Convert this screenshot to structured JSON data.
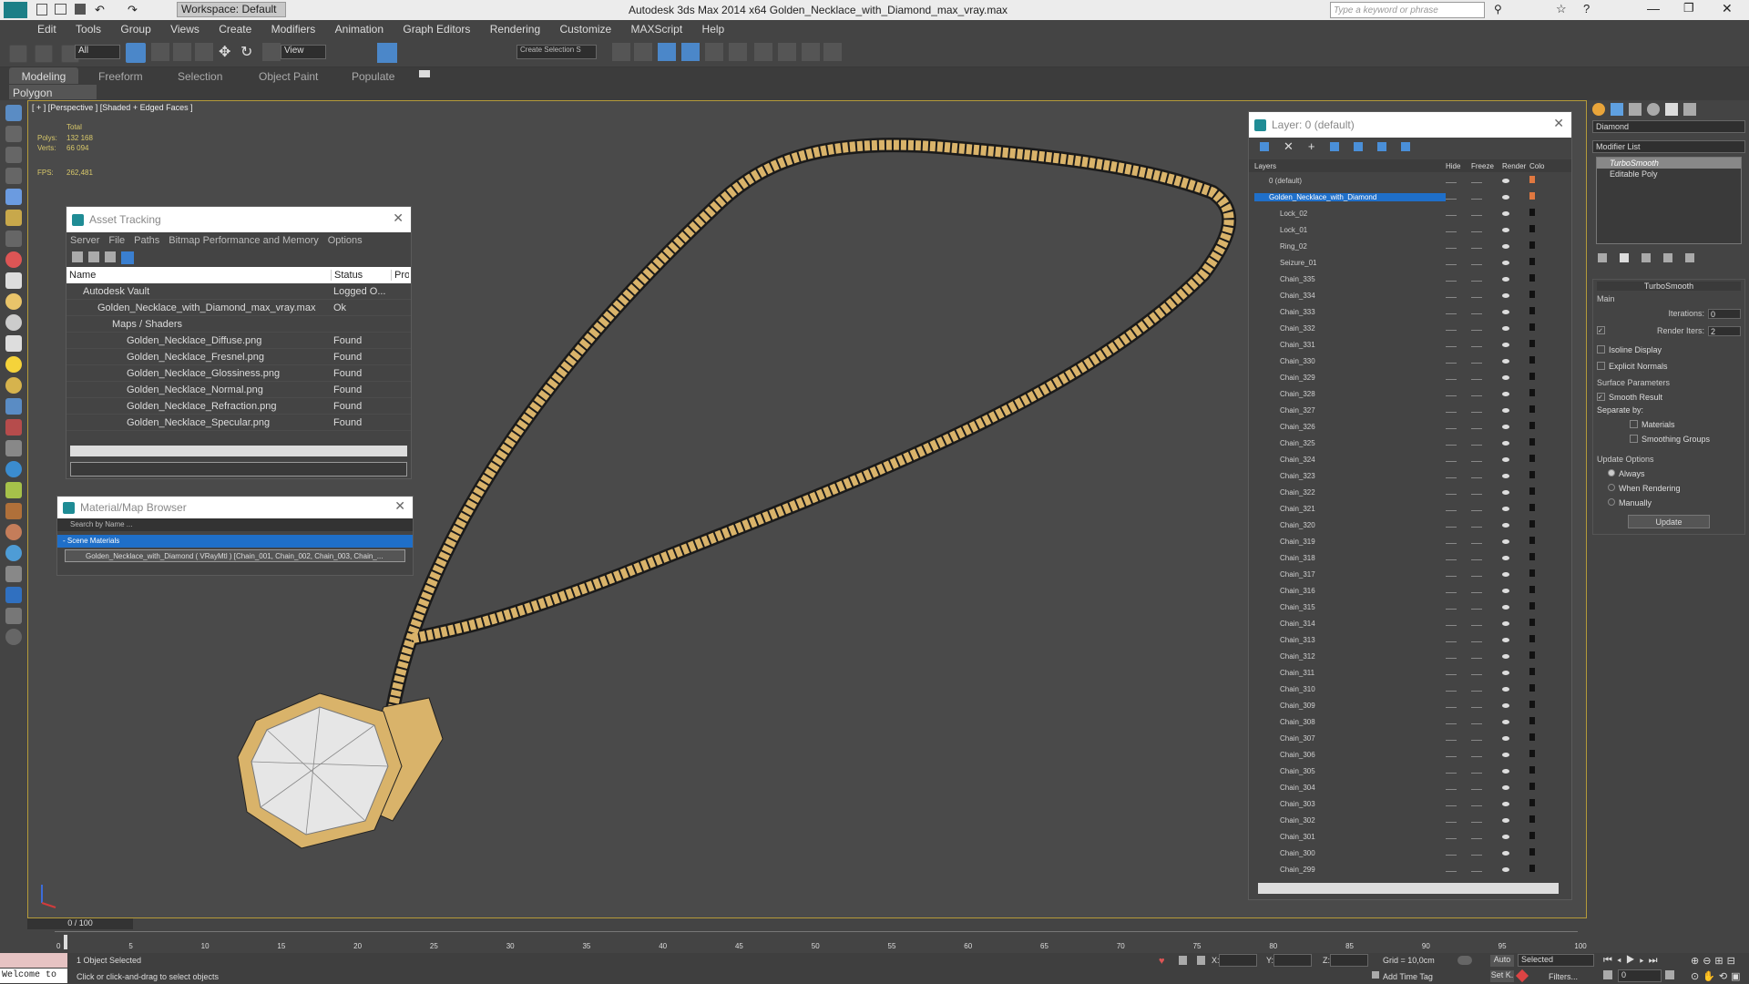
{
  "app": {
    "title": "Autodesk 3ds Max  2014 x64     Golden_Necklace_with_Diamond_max_vray.max",
    "workspace": "Workspace: Default",
    "search_placeholder": "Type a keyword or phrase"
  },
  "menu": [
    "Edit",
    "Tools",
    "Group",
    "Views",
    "Create",
    "Modifiers",
    "Animation",
    "Graph Editors",
    "Rendering",
    "Customize",
    "MAXScript",
    "Help"
  ],
  "toolbar": {
    "filter": "All",
    "ref": "View",
    "selset": "Create Selection S"
  },
  "ribbon": {
    "tabs": [
      "Modeling",
      "Freeform",
      "Selection",
      "Object Paint",
      "Populate"
    ],
    "sub": "Polygon Modeling"
  },
  "viewport": {
    "label": "[ + ] [Perspective ] [Shaded + Edged Faces ]",
    "stats_total": "Total",
    "polys_label": "Polys:",
    "polys_value": "132 168",
    "verts_label": "Verts:",
    "verts_value": "66 094",
    "fps_label": "FPS:",
    "fps_value": "262,481"
  },
  "asset_tracking": {
    "title": "Asset Tracking",
    "menu": [
      "Server",
      "File",
      "Paths",
      "Bitmap Performance and Memory",
      "Options"
    ],
    "columns": [
      "Name",
      "Status",
      "Pro"
    ],
    "rows": [
      {
        "name": "Autodesk Vault",
        "status": "Logged O..."
      },
      {
        "name": "Golden_Necklace_with_Diamond_max_vray.max",
        "status": "Ok"
      },
      {
        "name": "Maps / Shaders",
        "status": ""
      },
      {
        "name": "Golden_Necklace_Diffuse.png",
        "status": "Found"
      },
      {
        "name": "Golden_Necklace_Fresnel.png",
        "status": "Found"
      },
      {
        "name": "Golden_Necklace_Glossiness.png",
        "status": "Found"
      },
      {
        "name": "Golden_Necklace_Normal.png",
        "status": "Found"
      },
      {
        "name": "Golden_Necklace_Refraction.png",
        "status": "Found"
      },
      {
        "name": "Golden_Necklace_Specular.png",
        "status": "Found"
      }
    ]
  },
  "material_browser": {
    "title": "Material/Map Browser",
    "search": "Search by Name ...",
    "group": "- Scene Materials",
    "item": "Golden_Necklace_with_Diamond  ( VRayMtl ) [Chain_001, Chain_002, Chain_003, Chain_..."
  },
  "layer_manager": {
    "title": "Layer: 0 (default)",
    "columns": [
      "Layers",
      "Hide",
      "Freeze",
      "Render",
      "Colo"
    ],
    "layers": [
      "0 (default)",
      "Golden_Necklace_with_Diamond",
      "Lock_02",
      "Lock_01",
      "Ring_02",
      "Seizure_01",
      "Chain_335",
      "Chain_334",
      "Chain_333",
      "Chain_332",
      "Chain_331",
      "Chain_330",
      "Chain_329",
      "Chain_328",
      "Chain_327",
      "Chain_326",
      "Chain_325",
      "Chain_324",
      "Chain_323",
      "Chain_322",
      "Chain_321",
      "Chain_320",
      "Chain_319",
      "Chain_318",
      "Chain_317",
      "Chain_316",
      "Chain_315",
      "Chain_314",
      "Chain_313",
      "Chain_312",
      "Chain_311",
      "Chain_310",
      "Chain_309",
      "Chain_308",
      "Chain_307",
      "Chain_306",
      "Chain_305",
      "Chain_304",
      "Chain_303",
      "Chain_302",
      "Chain_301",
      "Chain_300",
      "Chain_299"
    ]
  },
  "command_panel": {
    "object_name": "Diamond",
    "modifier_list": "Modifier List",
    "stack": [
      "TurboSmooth",
      "Editable Poly"
    ],
    "rollout_title": "TurboSmooth",
    "main_label": "Main",
    "iterations_label": "Iterations:",
    "iterations_value": "0",
    "render_iters_label": "Render Iters:",
    "render_iters_value": "2",
    "isoline": "Isoline Display",
    "explicit": "Explicit Normals",
    "surface_params": "Surface Parameters",
    "smooth_result": "Smooth Result",
    "separate_by": "Separate by:",
    "materials": "Materials",
    "smoothing_groups": "Smoothing Groups",
    "update_options": "Update Options",
    "always": "Always",
    "when_rendering": "When Rendering",
    "manually": "Manually",
    "update_btn": "Update"
  },
  "timeline": {
    "frame": "0 / 100",
    "ticks": [
      "0",
      "5",
      "10",
      "15",
      "20",
      "25",
      "30",
      "35",
      "40",
      "45",
      "50",
      "55",
      "60",
      "65",
      "70",
      "75",
      "80",
      "85",
      "90",
      "95",
      "100"
    ]
  },
  "status": {
    "welcome": "Welcome to",
    "selected": "1 Object Selected",
    "prompt": "Click or click-and-drag to select objects",
    "x_label": "X:",
    "y_label": "Y:",
    "z_label": "Z:",
    "grid": "Grid = 10,0cm",
    "add_time_tag": "Add Time Tag",
    "auto": "Auto",
    "selected_dd": "Selected",
    "set_k": "Set K.",
    "filters": "Filters...",
    "frame_field": "0"
  }
}
